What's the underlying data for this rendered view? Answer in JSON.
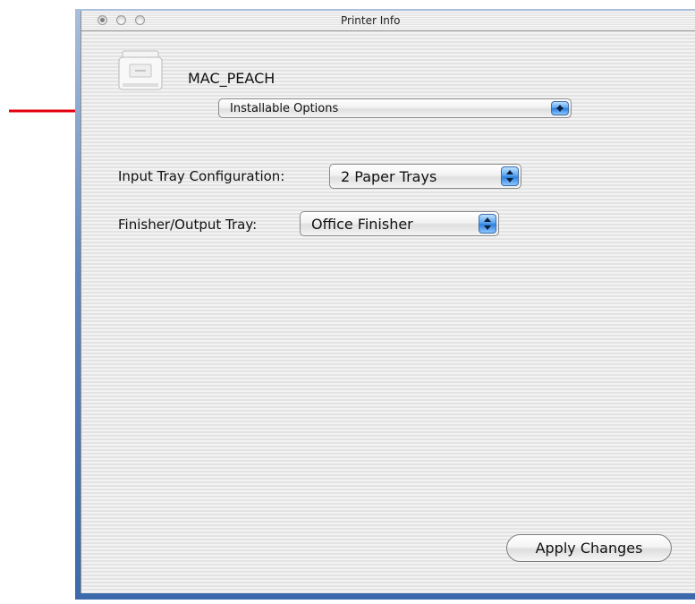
{
  "window": {
    "title": "Printer Info"
  },
  "printer": {
    "name": "MAC_PEACH",
    "icon": "printer-icon"
  },
  "panel_selector": {
    "selected": "Installable Options"
  },
  "options": {
    "input_tray": {
      "label": "Input Tray Configuration:",
      "value": "2 Paper Trays"
    },
    "finisher": {
      "label": "Finisher/Output Tray:",
      "value": "Office Finisher"
    }
  },
  "buttons": {
    "apply": "Apply Changes"
  },
  "colors": {
    "annotation_arrow": "#e3000f",
    "stepper_blue": "#2f80dd",
    "window_edge_blue": "#3c69ab"
  }
}
